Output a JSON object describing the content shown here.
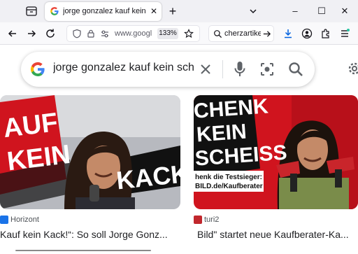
{
  "browser": {
    "tab_title": "jorge gonzalez kauf kein scheiß",
    "tab_close_glyph": "✕",
    "new_tab_glyph": "+",
    "window_minimize": "–",
    "window_maximize": "☐",
    "window_close": "✕",
    "url_text": "www.googl",
    "zoom_level": "133%",
    "search_text": "cherzartike"
  },
  "google": {
    "query": "jorge gonzalez kauf kein sch",
    "logo_colors": [
      "#4285F4",
      "#EA4335",
      "#FBBC05",
      "#34A853"
    ]
  },
  "results": [
    {
      "source": "Horizont",
      "headline": "Kauf kein Kack!“: So soll Jorge Gonz...",
      "image_words": [
        "AUF",
        "KEIN",
        "KACK"
      ],
      "source_color": "#1a73e8"
    },
    {
      "source": "turi2",
      "headline": "Bild\" startet neue Kaufberater-Ka...",
      "image_words": [
        "CHENK",
        "KEIN",
        "SCHEISS"
      ],
      "image_caption": [
        "henk die Testsieger:",
        "BILD.de/Kaufberater"
      ],
      "source_color": "#c1272d"
    }
  ],
  "colors": {
    "accent": "#1a73e8",
    "image_red": "#d0141e",
    "image_dark": "#111111"
  }
}
